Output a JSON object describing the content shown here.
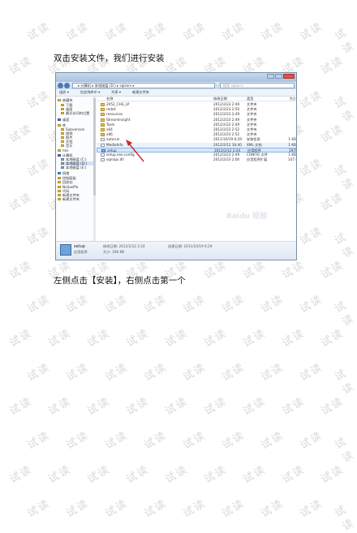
{
  "paragraphs": {
    "p1": "双击安装文件，我们进行安装",
    "p2": "左侧点击【安装】，右侧点击第一个"
  },
  "watermark_text": "试读",
  "window": {
    "address_path": "▸ 计算机 ▸ 本地磁盘 (D:) ▸ sqlserv ▸",
    "search_placeholder": "搜索 sqlserv",
    "toolbar": [
      "组织 ▾",
      "包含到库中 ▾",
      "共享 ▾",
      "新建文件夹"
    ],
    "columns": [
      "名称",
      "修改日期",
      "类型",
      "大小"
    ],
    "sidebar": [
      {
        "label": "收藏夹",
        "icon": "star"
      },
      {
        "label": "下载",
        "icon": "folder"
      },
      {
        "label": "桌面",
        "icon": "folder"
      },
      {
        "label": "最近访问的位置",
        "icon": "folder"
      },
      {
        "label": "桌面",
        "icon": "pc"
      },
      {
        "label": "库",
        "icon": "folder"
      },
      {
        "label": "Subversion",
        "icon": "folder"
      },
      {
        "label": "视频",
        "icon": "folder"
      },
      {
        "label": "图片",
        "icon": "folder"
      },
      {
        "label": "文档",
        "icon": "folder"
      },
      {
        "label": "音乐",
        "icon": "folder"
      },
      {
        "label": "mis",
        "icon": "folder"
      },
      {
        "label": "计算机",
        "icon": "pc"
      },
      {
        "label": "本地磁盘 (C:)",
        "icon": "drv"
      },
      {
        "label": "本地磁盘 (D:)",
        "icon": "drv"
      },
      {
        "label": "本地磁盘 (E:)",
        "icon": "drv"
      },
      {
        "label": "网络",
        "icon": "net"
      },
      {
        "label": "控制面板",
        "icon": "folder"
      },
      {
        "label": "回收站",
        "icon": "folder"
      },
      {
        "label": "NoSaslPa",
        "icon": "folder"
      },
      {
        "label": "代码",
        "icon": "folder"
      },
      {
        "label": "新建文件夹",
        "icon": "folder"
      },
      {
        "label": "新建文件夹",
        "icon": "folder"
      }
    ],
    "files": [
      {
        "name": "2052_CHS_LP",
        "date": "2012/2/23 2:49",
        "type": "文件夹",
        "size": "",
        "kind": "folder"
      },
      {
        "name": "redist",
        "date": "2012/2/23 2:50",
        "type": "文件夹",
        "size": "",
        "kind": "folder"
      },
      {
        "name": "resources",
        "date": "2012/2/23 2:49",
        "type": "文件夹",
        "size": "",
        "kind": "folder"
      },
      {
        "name": "StreamInsight",
        "date": "2012/2/23 2:49",
        "type": "文件夹",
        "size": "",
        "kind": "folder"
      },
      {
        "name": "Tools",
        "date": "2012/2/23 2:49",
        "type": "文件夹",
        "size": "",
        "kind": "folder"
      },
      {
        "name": "x64",
        "date": "2012/2/23 2:52",
        "type": "文件夹",
        "size": "",
        "kind": "folder"
      },
      {
        "name": "x86",
        "date": "2012/2/23 2:52",
        "type": "文件夹",
        "size": "",
        "kind": "folder"
      },
      {
        "name": "autorun",
        "date": "2011/10/19 6:29",
        "type": "安装信息",
        "size": "1 KB",
        "kind": "file"
      },
      {
        "name": "MediaInfo",
        "date": "2012/2/12 16:40",
        "type": "XML 文档",
        "size": "1 KB",
        "kind": "file"
      },
      {
        "name": "setup",
        "date": "2012/2/12 2:24",
        "type": "应用程序",
        "size": "197 KB",
        "kind": "exe"
      },
      {
        "name": "setup.exe.config",
        "date": "2012/2/23 2:49",
        "type": "CONFIG 文件",
        "size": "1 KB",
        "kind": "file"
      },
      {
        "name": "sqmapi.dll",
        "date": "2012/2/23 2:00",
        "type": "应用程序扩展",
        "size": "147 KB",
        "kind": "file"
      }
    ],
    "status": {
      "name": "setup",
      "type": "应用程序",
      "modified": "修改日期: 2012/2/12 2:24",
      "created": "创建日期: 2011/10/19 6:29",
      "size": "大小: 196 KB"
    }
  }
}
